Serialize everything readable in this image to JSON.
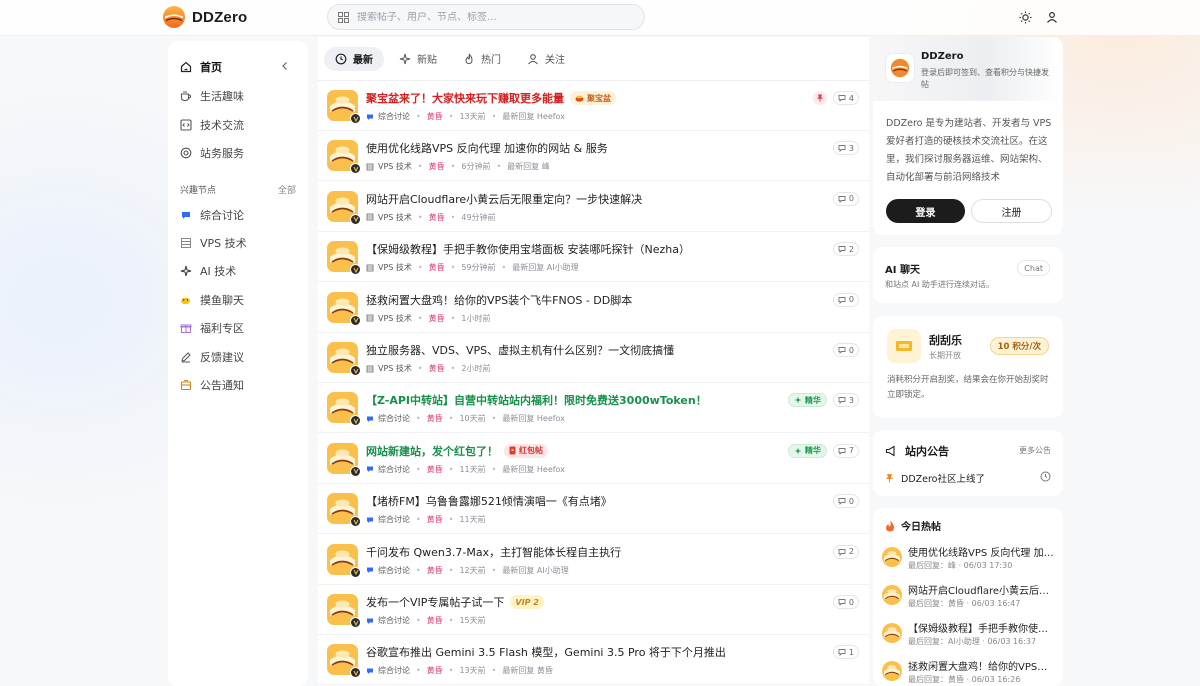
{
  "header": {
    "brand": "DDZero",
    "search_placeholder": "搜索帖子、用户、节点、标签..."
  },
  "sidebar": {
    "main": [
      {
        "label": "首页",
        "icon": "home-icon",
        "active": true
      },
      {
        "label": "生活趣味",
        "icon": "coffee-icon"
      },
      {
        "label": "技术交流",
        "icon": "code-icon"
      },
      {
        "label": "站务服务",
        "icon": "lifebuoy-icon"
      }
    ],
    "section_title": "兴趣节点",
    "section_all": "全部",
    "nodes": [
      {
        "label": "综合讨论",
        "icon": "chat-bubble-icon"
      },
      {
        "label": "VPS 技术",
        "icon": "server-icon"
      },
      {
        "label": "AI 技术",
        "icon": "sparkle-icon"
      },
      {
        "label": "摸鱼聊天",
        "icon": "fish-icon"
      },
      {
        "label": "福利专区",
        "icon": "gift-icon"
      },
      {
        "label": "反馈建议",
        "icon": "pencil-icon"
      },
      {
        "label": "公告通知",
        "icon": "inbox-icon"
      }
    ]
  },
  "tabs": [
    {
      "label": "最新",
      "icon": "clock-icon",
      "active": true
    },
    {
      "label": "新贴",
      "icon": "sparkle-icon"
    },
    {
      "label": "热门",
      "icon": "flame-icon"
    },
    {
      "label": "关注",
      "icon": "user-icon"
    }
  ],
  "posts": [
    {
      "title": "聚宝盆来了！大家快来玩下赚取更多能量",
      "style": "red",
      "tag": "聚宝盆",
      "tag_type": "jbp",
      "category": "综合讨论",
      "cat_icon": "chat",
      "author": "黄昏",
      "time": "13天前",
      "reply": "最新回复 Heefox",
      "count": "4",
      "pinned": true
    },
    {
      "title": "使用优化线路VPS 反向代理 加速你的网站 & 服务",
      "style": "",
      "category": "VPS 技术",
      "cat_icon": "server",
      "author": "黄昏",
      "time": "6分钟前",
      "reply": "最新回复 峰",
      "count": "3"
    },
    {
      "title": "网站开启Cloudflare小黄云后无限重定向？一步快速解决",
      "style": "",
      "category": "VPS 技术",
      "cat_icon": "server",
      "author": "黄昏",
      "time": "49分钟前",
      "reply": "",
      "count": "0"
    },
    {
      "title": "【保姆级教程】手把手教你使用宝塔面板 安装哪吒探针（Nezha）",
      "style": "",
      "category": "VPS 技术",
      "cat_icon": "server",
      "author": "黄昏",
      "time": "59分钟前",
      "reply": "最新回复 AI小助理",
      "count": "2"
    },
    {
      "title": "拯救闲置大盘鸡！给你的VPS装个飞牛FNOS - DD脚本",
      "style": "",
      "category": "VPS 技术",
      "cat_icon": "server",
      "author": "黄昏",
      "time": "1小时前",
      "reply": "",
      "count": "0"
    },
    {
      "title": "独立服务器、VDS、VPS、虚拟主机有什么区别？一文彻底搞懂",
      "style": "",
      "category": "VPS 技术",
      "cat_icon": "server",
      "author": "黄昏",
      "time": "2小时前",
      "reply": "",
      "count": "0"
    },
    {
      "title": "【Z-API中转站】自营中转站站内福利！限时免费送3000wToken！",
      "style": "green",
      "category": "综合讨论",
      "cat_icon": "chat",
      "author": "黄昏",
      "time": "10天前",
      "reply": "最新回复 Heefox",
      "count": "3",
      "badge": "精华"
    },
    {
      "title": "网站新建站，发个红包了！",
      "style": "green",
      "tag": "红包帖",
      "tag_type": "hb",
      "category": "综合讨论",
      "cat_icon": "chat",
      "author": "黄昏",
      "time": "11天前",
      "reply": "最新回复 Heefox",
      "count": "7",
      "badge": "精华"
    },
    {
      "title": "【堵桥FM】乌鲁鲁露娜521倾情演唱一《有点堵》",
      "style": "",
      "category": "综合讨论",
      "cat_icon": "chat",
      "author": "黄昏",
      "time": "11天前",
      "reply": "",
      "count": "0"
    },
    {
      "title": "千问发布 Qwen3.7-Max，主打智能体长程自主执行",
      "style": "",
      "category": "综合讨论",
      "cat_icon": "chat",
      "author": "黄昏",
      "time": "12天前",
      "reply": "最新回复 AI小助理",
      "count": "2"
    },
    {
      "title": "发布一个VIP专属帖子试一下",
      "style": "",
      "tag": "VIP 2",
      "tag_type": "vip",
      "category": "综合讨论",
      "cat_icon": "chat",
      "author": "黄昏",
      "time": "15天前",
      "reply": "",
      "count": "0"
    },
    {
      "title": "谷歌宣布推出 Gemini 3.5 Flash 模型，Gemini 3.5 Pro 将于下个月推出",
      "style": "",
      "category": "综合讨论",
      "cat_icon": "chat",
      "author": "黄昏",
      "time": "13天前",
      "reply": "最新回复 黄昏",
      "count": "1"
    }
  ],
  "user_card": {
    "name": "DDZero",
    "subtitle": "登录后即可签到、查看积分与快捷发帖",
    "description": "DDZero 是专为建站者、开发者与 VPS 爱好者打造的硬核技术交流社区。在这里，我们探讨服务器运维、网站架构、自动化部署与前沿网络技术",
    "login": "登录",
    "register": "注册"
  },
  "ai_card": {
    "title": "AI 聊天",
    "subtitle": "和站点 AI 助手进行连续对话。",
    "chat": "Chat"
  },
  "scratch_card": {
    "title": "刮刮乐",
    "subtitle": "长期开放",
    "cost": "10 积分/次",
    "desc": "消耗积分开启刮奖，结果会在你开始刮奖时立即锁定。"
  },
  "notice_card": {
    "title": "站内公告",
    "more": "更多公告",
    "item": "DDZero社区上线了"
  },
  "hot_card": {
    "title": "今日热帖",
    "items": [
      {
        "title": "使用优化线路VPS 反向代理 加速你的网站 & 服务",
        "meta": "最后回复：峰 · 06/03 17:30"
      },
      {
        "title": "网站开启Cloudflare小黄云后无限重定向？一步快速解决",
        "meta": "最后回复：黄昏 · 06/03 16:47"
      },
      {
        "title": "【保姆级教程】手把手教你使用宝塔面板 安装哪吒探针（Nezha）",
        "meta": "最后回复：AI小助理 · 06/03 16:37"
      },
      {
        "title": "拯救闲置大盘鸡！给你的VPS装个飞牛FNOS - DD脚本",
        "meta": "最后回复：黄昏 · 06/03 16:26"
      }
    ]
  },
  "colors": {
    "accent": "#1c1c1c",
    "red_title": "#d42020",
    "green_title": "#17914a",
    "author": "#e03a6a"
  }
}
